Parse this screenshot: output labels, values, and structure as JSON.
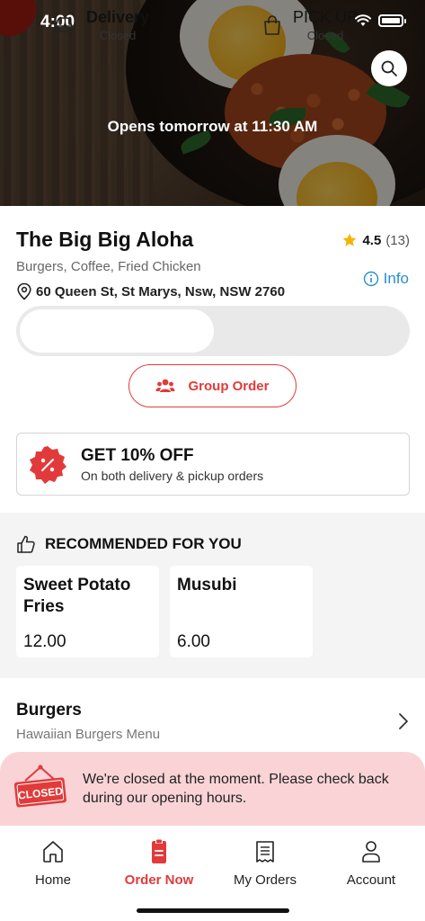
{
  "status_bar": {
    "time": "4:00"
  },
  "hero": {
    "opens_text": "Opens tomorrow at 11:30 AM"
  },
  "store": {
    "name": "The Big Big Aloha",
    "rating": "4.5",
    "rating_count": "(13)",
    "cuisine": "Burgers, Coffee, Fried Chicken",
    "address": "60 Queen St, St Marys, Nsw, NSW 2760",
    "info_label": "Info"
  },
  "order_mode": {
    "delivery": {
      "title": "Delivery",
      "status": "Closed"
    },
    "pickup": {
      "title": "PICK UP",
      "status": "Closed"
    },
    "selected": "delivery"
  },
  "group_order": {
    "label": "Group Order"
  },
  "promo": {
    "title": "GET 10% OFF",
    "subtitle": "On both delivery & pickup orders"
  },
  "recommended": {
    "heading": "RECOMMENDED FOR YOU",
    "items": [
      {
        "name": "Sweet Potato Fries",
        "price": "12.00"
      },
      {
        "name": "Musubi",
        "price": "6.00"
      }
    ]
  },
  "category": {
    "title": "Burgers",
    "subtitle": "Hawaiian Burgers Menu"
  },
  "closed_banner": {
    "sign_text": "CLOSED",
    "message": "We're closed at the moment. Please check back during our opening hours."
  },
  "tabbar": {
    "items": [
      {
        "label": "Home",
        "icon": "home-icon"
      },
      {
        "label": "Order Now",
        "icon": "order-icon"
      },
      {
        "label": "My Orders",
        "icon": "receipt-icon"
      },
      {
        "label": "Account",
        "icon": "user-icon"
      }
    ],
    "active_index": 1
  },
  "colors": {
    "accent": "#e23a3a",
    "info": "#2a8ed0",
    "star": "#f5b400",
    "banner_bg": "#f9d3d6"
  }
}
